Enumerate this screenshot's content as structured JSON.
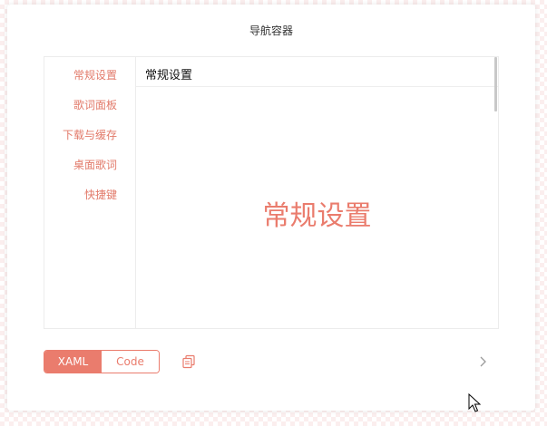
{
  "card": {
    "title": "导航容器"
  },
  "nav": {
    "items": [
      {
        "label": "常规设置"
      },
      {
        "label": "歌词面板"
      },
      {
        "label": "下载与缓存"
      },
      {
        "label": "桌面歌词"
      },
      {
        "label": "快捷键"
      }
    ],
    "selected_index": 0
  },
  "content": {
    "header": "常规设置",
    "body": "常规设置"
  },
  "code_toggle": {
    "options": [
      {
        "label": "XAML"
      },
      {
        "label": "Code"
      }
    ],
    "selected": "XAML"
  },
  "icons": {
    "copy": "copy-icon",
    "next": "chevron-right-icon",
    "cursor": "mouse-cursor-icon"
  },
  "colors": {
    "accent": "#ea7c6d",
    "nav_text": "#e27a6a",
    "border": "#ececec",
    "background_pattern": "#fbeeee"
  }
}
